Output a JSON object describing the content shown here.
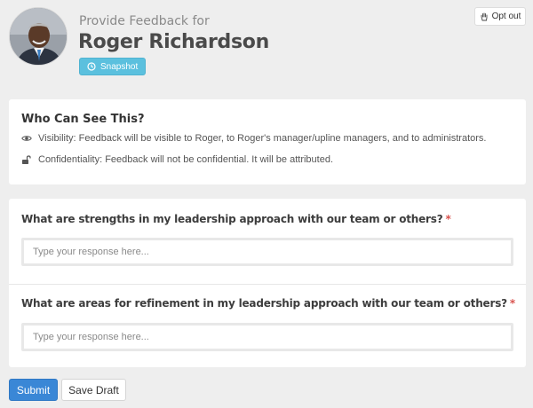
{
  "header": {
    "subtitle": "Provide Feedback for",
    "name": "Roger Richardson",
    "snapshot_label": "Snapshot",
    "optout_label": "Opt out",
    "icons": {
      "snapshot": "clock-icon",
      "optout": "hand-stop-icon",
      "avatar": "user-photo"
    }
  },
  "visibility": {
    "title": "Who Can See This?",
    "visibility_text": "Visibility: Feedback will be visible to Roger, to Roger's manager/upline managers, and to administrators.",
    "confidentiality_text": "Confidentiality: Feedback will not be confidential. It will be attributed.",
    "icons": {
      "visibility": "eye-icon",
      "confidentiality": "unlock-icon"
    }
  },
  "questions": [
    {
      "label": "What are strengths in my leadership approach with our team or others?",
      "required_mark": "*",
      "value": "",
      "placeholder": "Type your response here..."
    },
    {
      "label": "What are areas for refinement in my leadership approach with our team or others?",
      "required_mark": "*",
      "value": "",
      "placeholder": "Type your response here..."
    }
  ],
  "actions": {
    "submit_label": "Submit",
    "draft_label": "Save Draft"
  },
  "colors": {
    "snapshot": "#5bc0de",
    "submit": "#3a87d6",
    "required": "#d9534f",
    "background": "#eeeeee"
  }
}
